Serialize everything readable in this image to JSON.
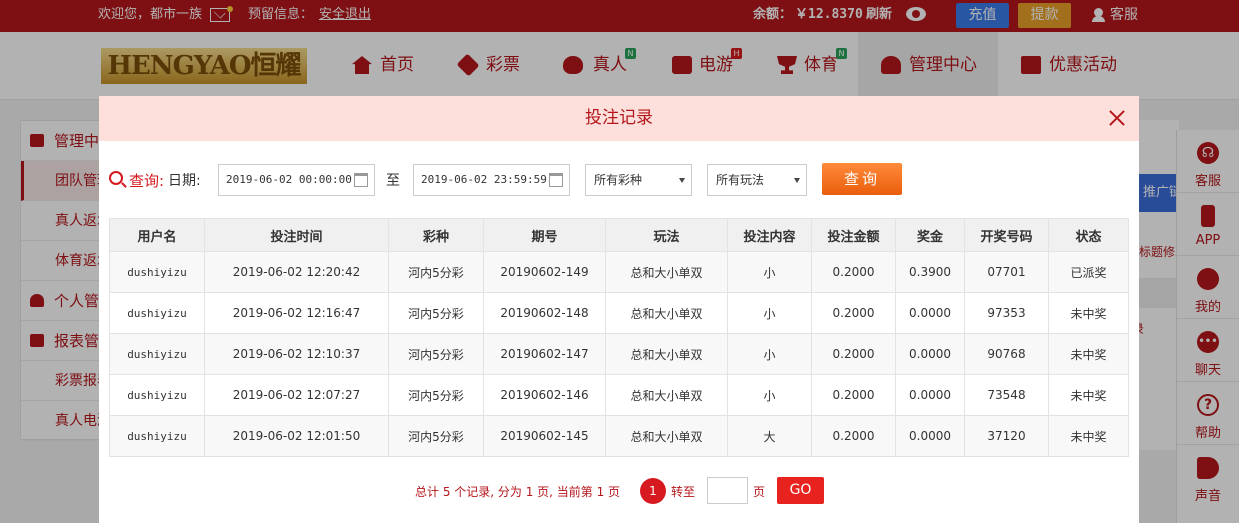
{
  "topbar": {
    "welcome": "欢迎您，都市一族",
    "message_label": "预留信息：",
    "logout": "安全退出",
    "balance_label": "余额：",
    "balance_value": "￥12.8370",
    "refresh": "刷新",
    "deposit": "充值",
    "withdraw": "提款",
    "service": "客服"
  },
  "nav": {
    "logo": "HENGYAO恒耀",
    "items": [
      {
        "label": "首页",
        "icon": "home-icon",
        "badge": ""
      },
      {
        "label": "彩票",
        "icon": "lottery-icon",
        "badge": ""
      },
      {
        "label": "真人",
        "icon": "live-casino-icon",
        "badge": "N"
      },
      {
        "label": "电游",
        "icon": "slot-game-icon",
        "badge": "H"
      },
      {
        "label": "体育",
        "icon": "trophy-icon",
        "badge": "N"
      },
      {
        "label": "管理中心",
        "icon": "users-icon",
        "badge": ""
      },
      {
        "label": "优惠活动",
        "icon": "gift-icon",
        "badge": ""
      }
    ]
  },
  "sidebar": {
    "items": [
      {
        "label": "管理中心",
        "type": "group"
      },
      {
        "label": "团队管理",
        "type": "active"
      },
      {
        "label": "真人返水",
        "type": "sub"
      },
      {
        "label": "体育返水",
        "type": "sub"
      },
      {
        "label": "个人管理",
        "type": "group"
      },
      {
        "label": "报表管理",
        "type": "group"
      },
      {
        "label": "彩票报表",
        "type": "sub"
      },
      {
        "label": "真人电游",
        "type": "sub"
      }
    ]
  },
  "right_panel": {
    "tag": "推广链接",
    "text1": "标题修改",
    "text2": "录"
  },
  "float_bar": [
    {
      "label": "客服",
      "icon": "headset-icon"
    },
    {
      "label": "APP",
      "icon": "phone-icon"
    },
    {
      "label": "我的",
      "icon": "user-icon"
    },
    {
      "label": "聊天",
      "icon": "chat-icon"
    },
    {
      "label": "帮助",
      "icon": "help-icon"
    },
    {
      "label": "声音",
      "icon": "speaker-icon"
    }
  ],
  "modal": {
    "title": "投注记录",
    "query_label": "查询:",
    "date_label": "日期:",
    "start_date": "2019-06-02 00:00:00",
    "to_label": "至",
    "end_date": "2019-06-02 23:59:59",
    "lottery_select": "所有彩种",
    "play_select": "所有玩法",
    "query_button": "查询",
    "table": {
      "headers": [
        "用户名",
        "投注时间",
        "彩种",
        "期号",
        "玩法",
        "投注内容",
        "投注金额",
        "奖金",
        "开奖号码",
        "状态"
      ],
      "rows": [
        {
          "user": "dushiyizu",
          "time": "2019-06-02 12:20:42",
          "lottery": "河内5分彩",
          "issue": "20190602-149",
          "play": "总和大小单双",
          "content": "小",
          "amount": "0.2000",
          "prize": "0.3900",
          "numbers": "07701",
          "status": "已派奖",
          "won": true
        },
        {
          "user": "dushiyizu",
          "time": "2019-06-02 12:16:47",
          "lottery": "河内5分彩",
          "issue": "20190602-148",
          "play": "总和大小单双",
          "content": "小",
          "amount": "0.2000",
          "prize": "0.0000",
          "numbers": "97353",
          "status": "未中奖",
          "won": false
        },
        {
          "user": "dushiyizu",
          "time": "2019-06-02 12:10:37",
          "lottery": "河内5分彩",
          "issue": "20190602-147",
          "play": "总和大小单双",
          "content": "小",
          "amount": "0.2000",
          "prize": "0.0000",
          "numbers": "90768",
          "status": "未中奖",
          "won": false
        },
        {
          "user": "dushiyizu",
          "time": "2019-06-02 12:07:27",
          "lottery": "河内5分彩",
          "issue": "20190602-146",
          "play": "总和大小单双",
          "content": "小",
          "amount": "0.2000",
          "prize": "0.0000",
          "numbers": "73548",
          "status": "未中奖",
          "won": false
        },
        {
          "user": "dushiyizu",
          "time": "2019-06-02 12:01:50",
          "lottery": "河内5分彩",
          "issue": "20190602-145",
          "play": "总和大小单双",
          "content": "大",
          "amount": "0.2000",
          "prize": "0.0000",
          "numbers": "37120",
          "status": "未中奖",
          "won": false
        }
      ]
    },
    "pagination": {
      "summary": "总计 5 个记录, 分为 1 页, 当前第 1 页",
      "current_page": "1",
      "goto_label": "转至",
      "page_unit": "页",
      "go_button": "GO"
    }
  },
  "colors": {
    "brand_red": "#b5161b",
    "accent_red": "#d61a1f",
    "deposit_blue": "#3b7be8",
    "withdraw_orange": "#e8a12a",
    "query_orange": "#ee6a16",
    "modal_header": "#fde0dc"
  }
}
